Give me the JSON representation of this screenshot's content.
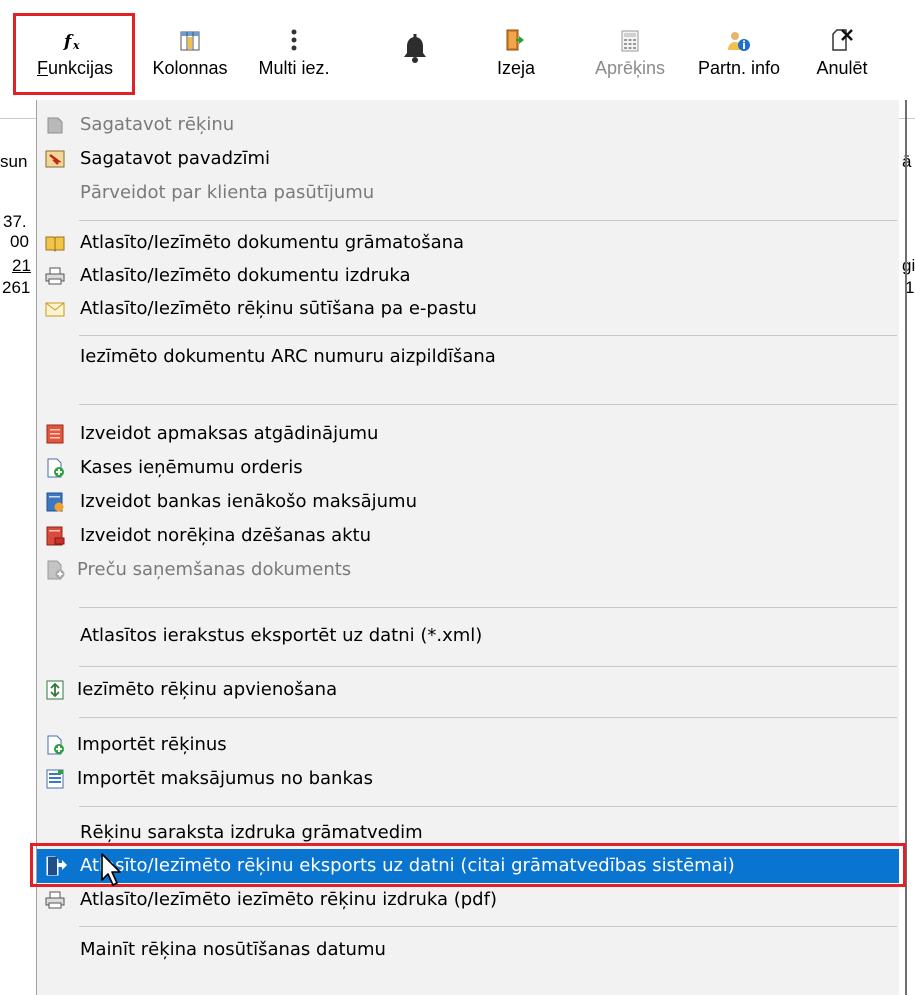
{
  "toolbar": {
    "buttons": [
      {
        "icon": "fx-icon",
        "label_underlined": "F",
        "label_rest": "unkcijas",
        "highlighted": true
      },
      {
        "icon": "columns-icon",
        "label": "Kolonnas"
      },
      {
        "icon": "vertical-dots-icon",
        "label": "Multi iez."
      },
      {
        "icon": "bell-icon",
        "label": ""
      },
      {
        "icon": "exit-door-icon",
        "label": "Izeja"
      },
      {
        "icon": "calculator-icon",
        "label": "Aprēķins",
        "disabled": true
      },
      {
        "icon": "partner-info-icon",
        "label": "Partn. info"
      },
      {
        "icon": "cancel-document-icon",
        "label": "Anulēt"
      }
    ]
  },
  "background": {
    "fragments": [
      "sun",
      "37.",
      "00",
      "21",
      "261",
      "ā",
      "gi",
      "1"
    ]
  },
  "menu": {
    "items": [
      {
        "label": "Sagatavot rēķinu",
        "icon": "invoice-icon",
        "disabled": true
      },
      {
        "label": "Sagatavot pavadzīmi",
        "icon": "waybill-icon"
      },
      {
        "label": "Pārveidot par klienta pasūtījumu",
        "disabled": true
      },
      {
        "label": "Atlasīto/Iezīmēto dokumentu grāmatošana",
        "icon": "book-icon"
      },
      {
        "label": "Atlasīto/Iezīmēto dokumentu izdruka",
        "icon": "printer-icon"
      },
      {
        "label": "Atlasīto/Iezīmēto rēķinu sūtīšana pa e-pastu",
        "icon": "envelope-icon"
      },
      {
        "label": "Iezīmēto dokumentu ARC numuru aizpildīšana"
      },
      {
        "label": "Izveidot apmaksas atgādinājumu",
        "icon": "reminder-icon"
      },
      {
        "label": "Kases ieņēmumu orderis",
        "icon": "cash-order-icon"
      },
      {
        "label": "Izveidot bankas ienākošo maksājumu",
        "icon": "bank-payment-icon"
      },
      {
        "label": "Izveidot norēķina dzēšanas aktu",
        "icon": "settlement-act-icon"
      },
      {
        "label": "Preču saņemšanas dokuments",
        "icon": "goods-receipt-icon",
        "disabled": true
      },
      {
        "label": "Atlasītos ierakstus eksportēt uz datni (*.xml)"
      },
      {
        "label": "Iezīmēto rēķinu apvienošana",
        "icon": "merge-icon"
      },
      {
        "label": "Importēt rēķinus",
        "icon": "import-invoice-icon"
      },
      {
        "label": "Importēt maksājumus no bankas",
        "icon": "import-bank-icon"
      },
      {
        "label": "Rēķinu saraksta izdruka grāmatvedim"
      },
      {
        "label": "Atlasīto/Iezīmēto rēķinu eksports uz datni (citai grāmatvedības sistēmai)",
        "icon": "export-file-icon",
        "selected": true
      },
      {
        "label": "Atlasīto/Iezīmēto iezīmēto rēķinu izdruka (pdf)",
        "icon": "printer-icon"
      },
      {
        "label": "Mainīt rēķina nosūtīšanas datumu"
      }
    ]
  },
  "colors": {
    "highlight_box": "#e22127",
    "selection": "#0a74d1"
  }
}
